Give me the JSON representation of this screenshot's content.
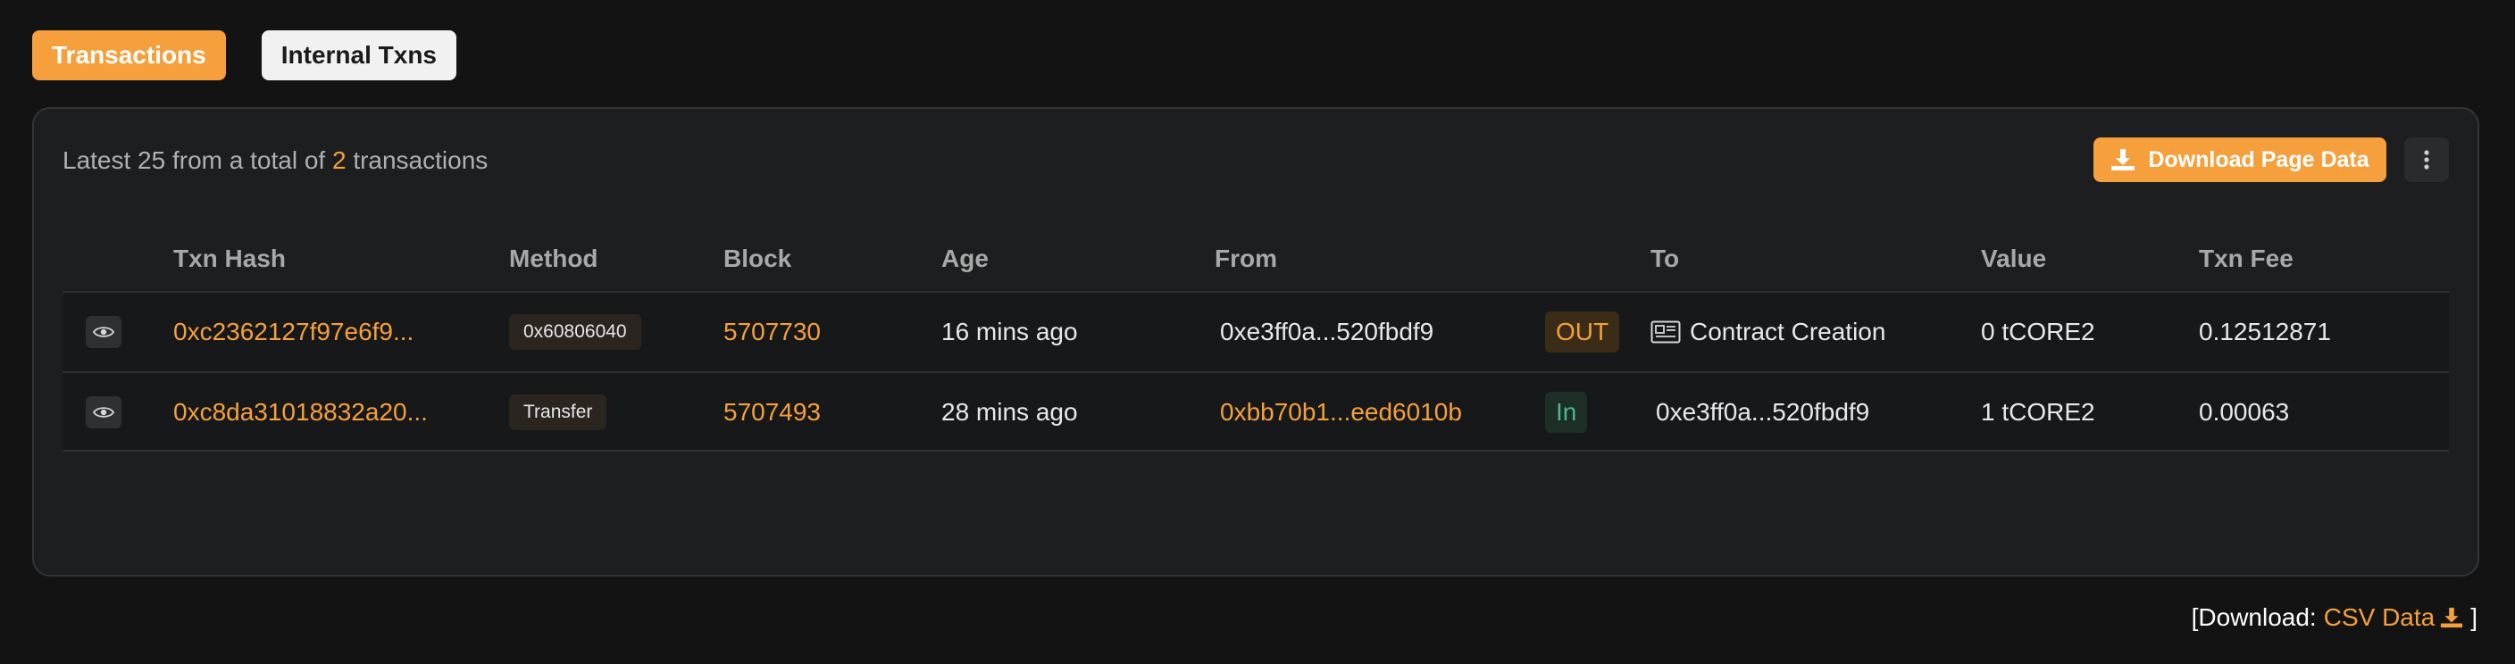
{
  "tabs": [
    {
      "label": "Transactions",
      "active": true
    },
    {
      "label": "Internal Txns",
      "active": false
    }
  ],
  "summary": {
    "prefix": "Latest 25 from a total of",
    "count": "2",
    "suffix": "transactions"
  },
  "toolbar": {
    "download_label": "Download Page Data",
    "download_icon": "download-icon",
    "more_icon": "more-vertical-icon"
  },
  "table": {
    "headers": [
      "Txn Hash",
      "Method",
      "Block",
      "Age",
      "From",
      "To",
      "Value",
      "Txn Fee"
    ],
    "rows": [
      {
        "hash": "0xc2362127f97e6f9...",
        "method": "0x60806040",
        "block": "5707730",
        "age": "16 mins ago",
        "from": "0xe3ff0a...520fbdf9",
        "direction": "OUT",
        "to": "Contract Creation",
        "value": "0 tCORE2",
        "fee": "0.12512871"
      },
      {
        "hash": "0xc8da31018832a20...",
        "method": "Transfer",
        "block": "5707493",
        "age": "28 mins ago",
        "from": "0xbb70b1...eed6010b",
        "direction": "In",
        "to": "0xe3ff0a...520fbdf9",
        "value": "1 tCORE2",
        "fee": "0.00063"
      }
    ]
  },
  "footer": {
    "open": "[Download:",
    "link": "CSV Data",
    "close": "]"
  },
  "colors": {
    "accent": "#f5a03c",
    "in_green": "#4fb58a",
    "background": "#131313",
    "card": "#1d1e1f"
  }
}
